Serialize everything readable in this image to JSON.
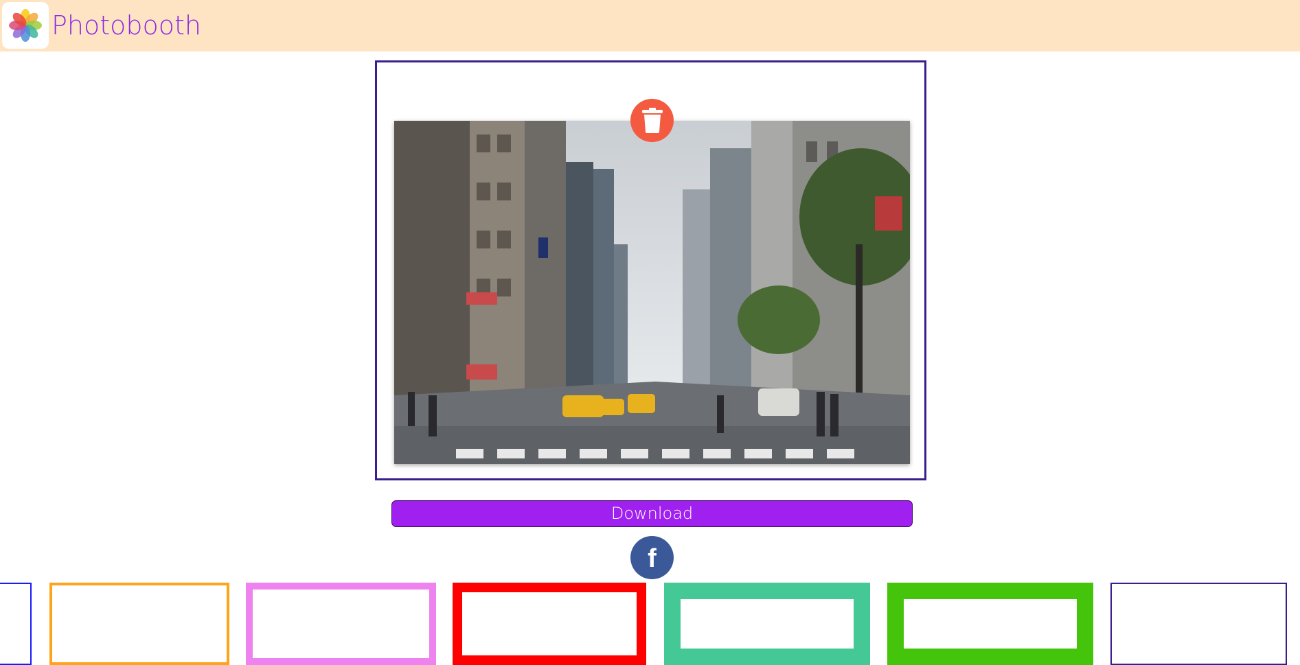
{
  "app": {
    "title": "Photobooth",
    "logo_icon": "photos-flower-icon"
  },
  "photo": {
    "icon": "street-photo-image",
    "delete_icon": "trash-icon"
  },
  "actions": {
    "download_label": "Download",
    "share_icon": "facebook-icon",
    "share_glyph": "f"
  },
  "colors": {
    "header_bg": "#ffe4c4",
    "title": "#8a2be2",
    "frame_border": "#3a1e8c",
    "delete": "#f45a3f",
    "download": "#a020f0",
    "facebook": "#3b5998"
  },
  "frame_options": [
    {
      "color": "#1a1aff"
    },
    {
      "color": "#ffa31a"
    },
    {
      "color": "#ee82ee"
    },
    {
      "color": "#ff0000"
    },
    {
      "color": "#44c896"
    },
    {
      "color": "#44c40a"
    },
    {
      "color": "#3a1e8c"
    }
  ]
}
